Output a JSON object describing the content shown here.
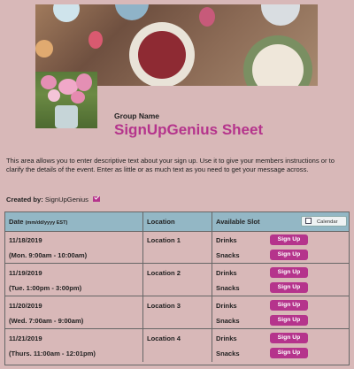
{
  "header": {
    "group_label": "Group Name",
    "sheet_title": "SignUpGenius Sheet"
  },
  "description": "This area allows you to enter descriptive text about your sign up. Use it to give your members instructions or to clarify the details of the event. Enter as little or as much text as you need to get your message across.",
  "created_by": {
    "label": "Created by:",
    "name": "SignUpGenius",
    "icon": "mail-icon"
  },
  "table": {
    "headers": {
      "date": "Date",
      "date_format": "(mm/dd/yyyy EST)",
      "location": "Location",
      "slot": "Available Slot",
      "calendar_button": "Calendar"
    },
    "rows": [
      {
        "date": "11/18/2019",
        "time": "(Mon. 9:00am - 10:00am)",
        "location": "Location 1",
        "slots": [
          {
            "name": "Drinks",
            "button": "Sign Up"
          },
          {
            "name": "Snacks",
            "button": "Sign Up"
          }
        ]
      },
      {
        "date": "11/19/2019",
        "time": "(Tue. 1:00pm - 3:00pm)",
        "location": "Location 2",
        "slots": [
          {
            "name": "Drinks",
            "button": "Sign Up"
          },
          {
            "name": "Snacks",
            "button": "Sign Up"
          }
        ]
      },
      {
        "date": "11/20/2019",
        "time": "(Wed. 7:00am - 9:00am)",
        "location": "Location 3",
        "slots": [
          {
            "name": "Drinks",
            "button": "Sign Up"
          },
          {
            "name": "Snacks",
            "button": "Sign Up"
          }
        ]
      },
      {
        "date": "11/21/2019",
        "time": "(Thurs. 11:00am - 12:01pm)",
        "location": "Location 4",
        "slots": [
          {
            "name": "Drinks",
            "button": "Sign Up"
          },
          {
            "name": "Snacks",
            "button": "Sign Up"
          }
        ]
      }
    ]
  },
  "colors": {
    "background": "#d8b8b8",
    "accent": "#b5348c",
    "table_header": "#93b7c5"
  }
}
